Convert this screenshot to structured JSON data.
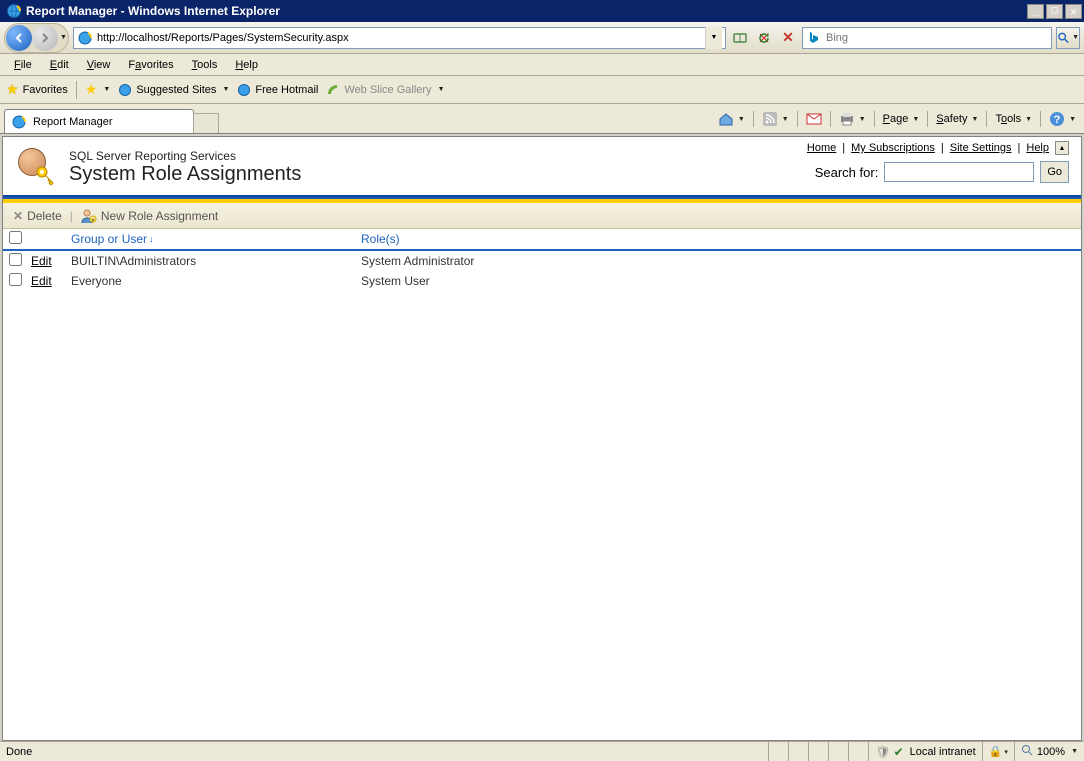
{
  "window": {
    "title": "Report Manager - Windows Internet Explorer"
  },
  "address": {
    "url": "http://localhost/Reports/Pages/SystemSecurity.aspx"
  },
  "search_provider": {
    "placeholder": "Bing"
  },
  "menus": {
    "file": "File",
    "edit": "Edit",
    "view": "View",
    "favorites": "Favorites",
    "tools": "Tools",
    "help": "Help"
  },
  "favbar": {
    "favorites": "Favorites",
    "suggested": "Suggested Sites",
    "hotmail": "Free Hotmail",
    "webslice": "Web Slice Gallery"
  },
  "tab": {
    "title": "Report Manager"
  },
  "cmdbar": {
    "page": "Page",
    "safety": "Safety",
    "tools": "Tools"
  },
  "toplinks": {
    "home": "Home",
    "mysubs": "My Subscriptions",
    "sitesettings": "Site Settings",
    "help": "Help"
  },
  "searchfor": {
    "label": "Search for:",
    "go": "Go"
  },
  "ssrs": {
    "subtitle": "SQL Server Reporting Services",
    "title": "System Role Assignments"
  },
  "actions": {
    "delete": "Delete",
    "newrole": "New Role Assignment"
  },
  "columns": {
    "group": "Group or User",
    "roles": "Role(s)"
  },
  "rows": [
    {
      "edit": "Edit",
      "group": "BUILTIN\\Administrators",
      "role": "System Administrator"
    },
    {
      "edit": "Edit",
      "group": "Everyone",
      "role": "System User"
    }
  ],
  "status": {
    "done": "Done",
    "zone": "Local intranet",
    "zoom": "100%"
  }
}
